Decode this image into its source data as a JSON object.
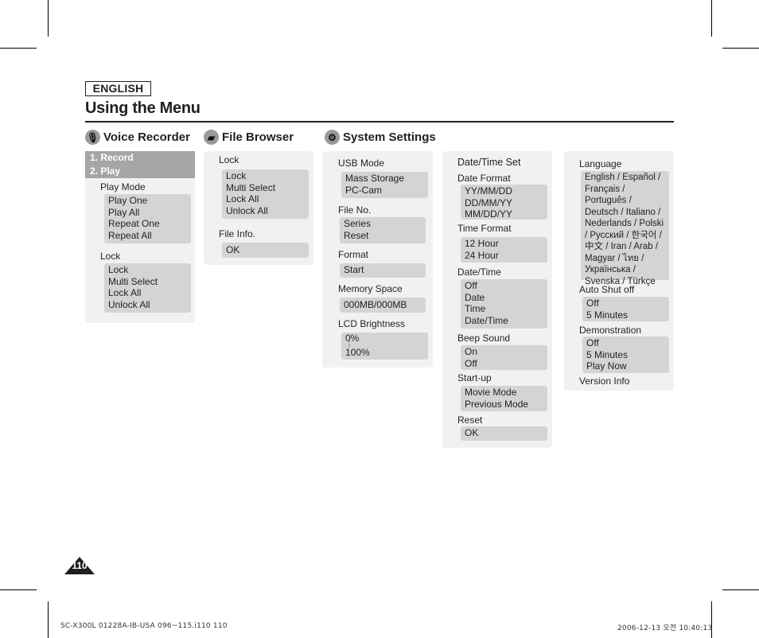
{
  "badge": "ENGLISH",
  "title": "Using the Menu",
  "sections": {
    "voice_recorder": {
      "heading": "Voice Recorder",
      "icon": "microphone-icon",
      "items": [
        "1. Record",
        "2. Play"
      ],
      "play_mode": {
        "label": "Play Mode",
        "options": [
          "Play One",
          "Play All",
          "Repeat One",
          "Repeat All"
        ]
      },
      "lock": {
        "label": "Lock",
        "options": [
          "Lock",
          "Multi Select",
          "Lock All",
          "Unlock All"
        ]
      }
    },
    "file_browser": {
      "heading": "File Browser",
      "icon": "folder-icon",
      "lock": {
        "label": "Lock",
        "options": [
          "Lock",
          "Multi Select",
          "Lock All",
          "Unlock All"
        ]
      },
      "file_info": {
        "label": "File Info.",
        "options": [
          "OK"
        ]
      }
    },
    "system_settings": {
      "heading": "System Settings",
      "icon": "gear-icon",
      "usb_mode": {
        "label": "USB Mode",
        "options": [
          "Mass Storage",
          "PC-Cam"
        ]
      },
      "file_no": {
        "label": "File No.",
        "options": [
          "Series",
          "Reset"
        ]
      },
      "format": {
        "label": "Format",
        "options": [
          "Start"
        ]
      },
      "memory_space": {
        "label": "Memory Space",
        "options": [
          "000MB/000MB"
        ]
      },
      "lcd_brightness": {
        "label": "LCD Brightness",
        "options": [
          "0%",
          "⋮",
          "100%"
        ]
      },
      "date_time_set": "Date/Time Set",
      "date_format": {
        "label": "Date Format",
        "options": [
          "YY/MM/DD",
          "DD/MM/YY",
          "MM/DD/YY"
        ]
      },
      "time_format": {
        "label": "Time Format",
        "options": [
          "12 Hour",
          "24 Hour"
        ]
      },
      "date_time": {
        "label": "Date/Time",
        "options": [
          "Off",
          "Date",
          "Time",
          "Date/Time"
        ]
      },
      "beep_sound": {
        "label": "Beep Sound",
        "options": [
          "On",
          "Off"
        ]
      },
      "start_up": {
        "label": "Start-up",
        "options": [
          "Movie Mode",
          "Previous Mode"
        ]
      },
      "reset": {
        "label": "Reset",
        "options": [
          "OK"
        ]
      },
      "language": {
        "label": "Language",
        "options": "English / Español / Français / Português / Deutsch / Italiano / Nederlands / Polski / Русский / 한국어 / 中文 / Iran / Arab / Magyar / ไทย / Українська / Svenska / Türkçe"
      },
      "auto_shut_off": {
        "label": "Auto Shut off",
        "options": [
          "Off",
          "5 Minutes"
        ]
      },
      "demonstration": {
        "label": "Demonstration",
        "options": [
          "Off",
          "5 Minutes",
          "Play Now"
        ]
      },
      "version_info": "Version Info"
    }
  },
  "page_number": "110",
  "footer": {
    "left": "SC-X300L 01228A-IB-USA 096~115.i110   110",
    "right": "2006-12-13   오전 10:40:13"
  }
}
